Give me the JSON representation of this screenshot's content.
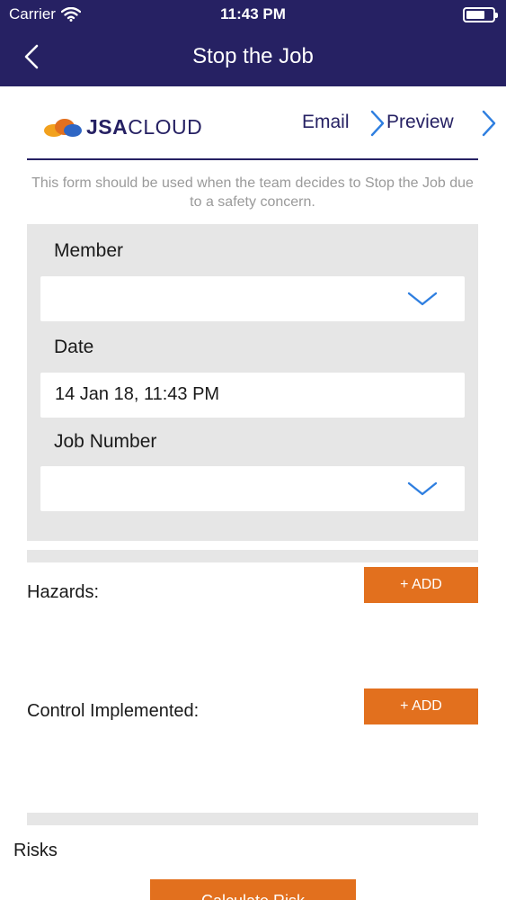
{
  "status_bar": {
    "carrier": "Carrier",
    "time": "11:43 PM"
  },
  "nav": {
    "title": "Stop the Job"
  },
  "header": {
    "logo_bold": "JSA",
    "logo_light": "CLOUD",
    "email_label": "Email",
    "preview_label": "Preview"
  },
  "intro": "This form should be used when the team decides to Stop the Job due to a safety concern.",
  "form": {
    "member": {
      "label": "Member",
      "value": ""
    },
    "date": {
      "label": "Date",
      "value": "14 Jan 18, 11:43 PM"
    },
    "job_number": {
      "label": "Job Number",
      "value": ""
    }
  },
  "hazards": {
    "label": "Hazards:",
    "add_label": "+ ADD"
  },
  "controls": {
    "label": "Control Implemented:",
    "add_label": "+ ADD"
  },
  "risks": {
    "label": "Risks",
    "calculate_label": "Calculate Risk"
  },
  "colors": {
    "nav_bg": "#262163",
    "accent": "#e2701e",
    "panel_bg": "#e6e6e6",
    "link_blue": "#2f7fe0"
  }
}
